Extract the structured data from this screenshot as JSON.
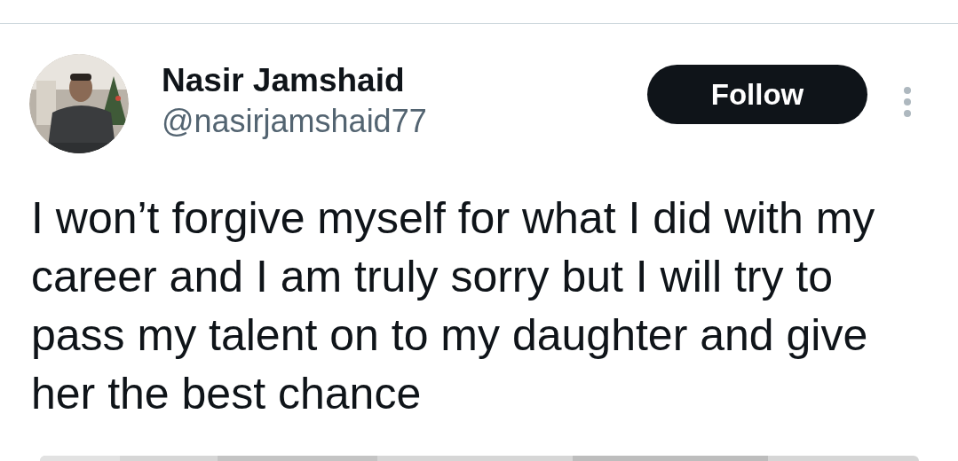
{
  "tweet": {
    "author": {
      "name": "Nasir Jamshaid",
      "handle": "@nasirjamshaid77"
    },
    "follow_button": {
      "label": "Follow"
    },
    "text": "I won’t forgive myself for what I did with my career and I am truly sorry but I will try to pass my talent on to my daughter and give her the best chance"
  }
}
